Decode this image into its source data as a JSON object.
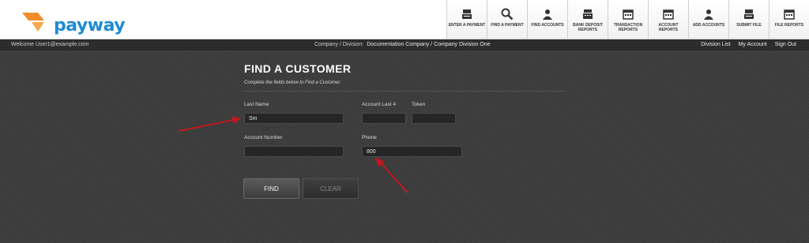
{
  "brand": {
    "name": "payway",
    "accent": "#1f8bd1",
    "mark_color": "#f28c28"
  },
  "nav": [
    {
      "label": "ENTER A PAYMENT",
      "icon": "terminal-icon"
    },
    {
      "label": "FIND A PAYMENT",
      "icon": "search-icon"
    },
    {
      "label": "FIND ACCOUNTS",
      "icon": "person-icon"
    },
    {
      "label": "BANK DEPOSIT REPORTS",
      "icon": "register-icon"
    },
    {
      "label": "TRANSACTION REPORTS",
      "icon": "calendar-icon"
    },
    {
      "label": "ACCOUNT REPORTS",
      "icon": "calendar-icon"
    },
    {
      "label": "ADD ACCOUNTS",
      "icon": "person-icon"
    },
    {
      "label": "SUBMIT FILE",
      "icon": "terminal-icon"
    },
    {
      "label": "FILE REPORTS",
      "icon": "calendar-icon"
    }
  ],
  "strip": {
    "welcome": "Welcome User1@example.com",
    "division_label": "Company / Division:",
    "division_value": "Documentation Company / Company Division One",
    "links": [
      "Division List",
      "My Account",
      "Sign Out"
    ]
  },
  "form": {
    "title": "FIND A CUSTOMER",
    "subtitle": "Complete the fields below to Find a Customer.",
    "last_name_label": "Last Name",
    "last_name_value": "Sm",
    "account_last4_label": "Account Last 4",
    "account_last4_value": "",
    "token_label": "Token",
    "token_value": "",
    "account_number_label": "Account Number",
    "account_number_value": "",
    "phone_label": "Phone",
    "phone_value": "800",
    "find_label": "FIND",
    "clear_label": "CLEAR"
  },
  "annotation_color": "#c0181e"
}
